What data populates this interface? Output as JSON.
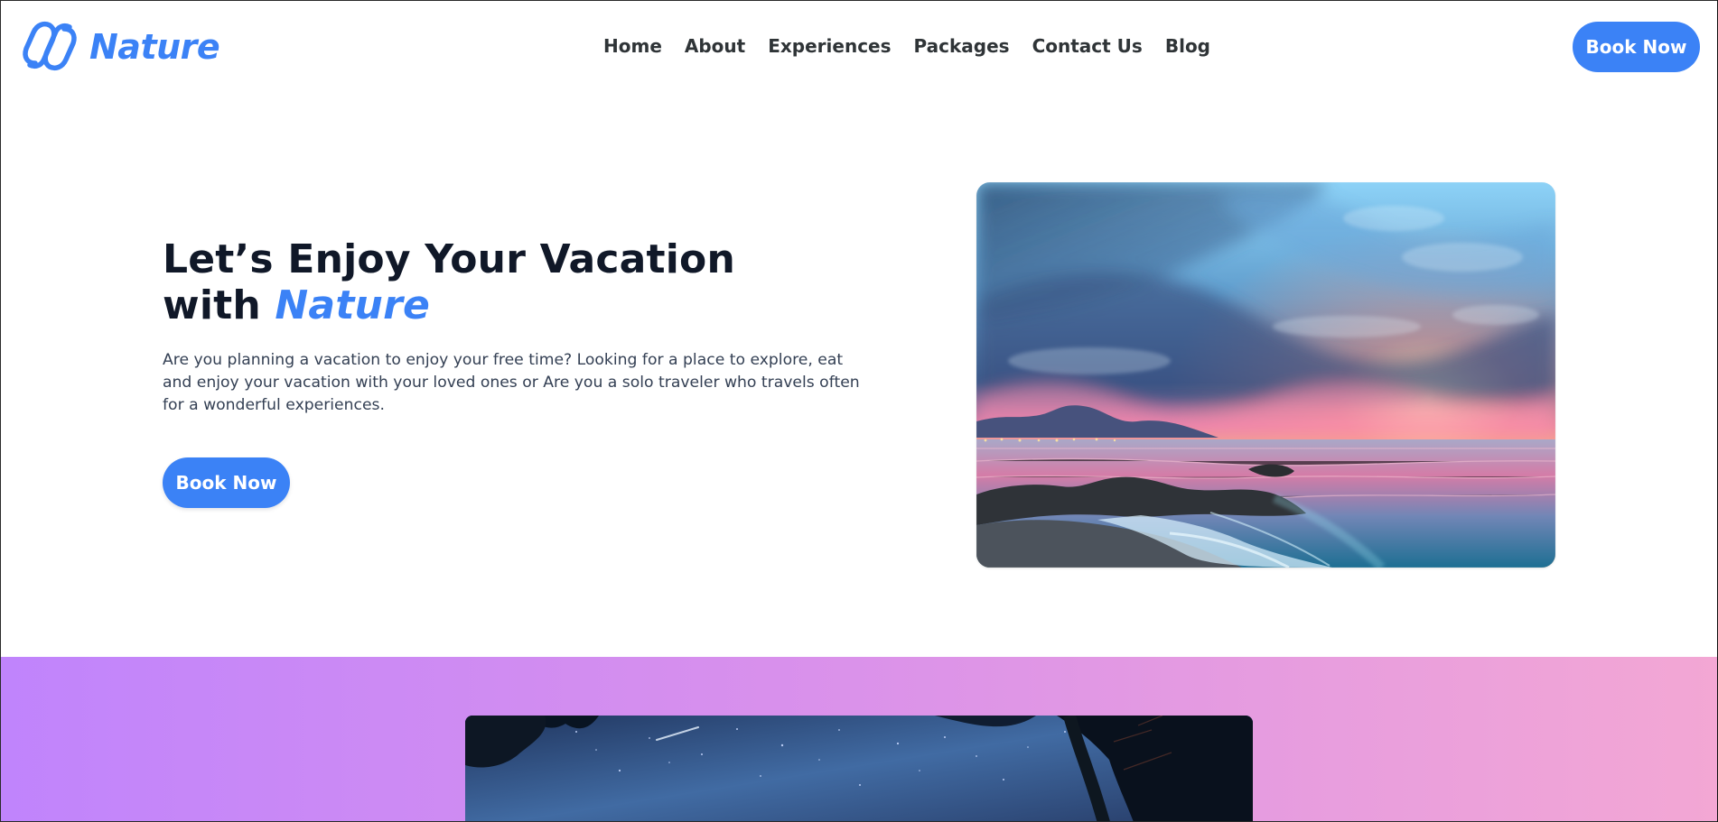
{
  "brand": {
    "name": "Nature",
    "icon": "infinity-logo-icon",
    "color": "#3b82f6"
  },
  "navigation": {
    "items": [
      {
        "label": "Home"
      },
      {
        "label": "About"
      },
      {
        "label": "Experiences"
      },
      {
        "label": "Packages"
      },
      {
        "label": "Contact Us"
      },
      {
        "label": "Blog"
      }
    ],
    "cta_label": "Book Now"
  },
  "hero": {
    "title_line_1": "Let’s Enjoy Your Vacation",
    "title_prefix_line_2": "with ",
    "title_accent": "Nature",
    "description": "Are you planning a vacation to enjoy your free time? Looking for a place to explore, eat and enjoy your vacation with your loved ones or Are you a solo traveler who travels often for a wonderful experiences.",
    "cta_label": "Book Now",
    "image_icon": "seaside-sunset-image"
  },
  "gallery": {
    "image_icon": "starry-night-forest-image"
  },
  "colors": {
    "primary": "#3b82f6",
    "heading": "#101828",
    "body_text": "#344054",
    "section_gradient_start": "#c084fc",
    "section_gradient_end": "#f3a7d4"
  }
}
